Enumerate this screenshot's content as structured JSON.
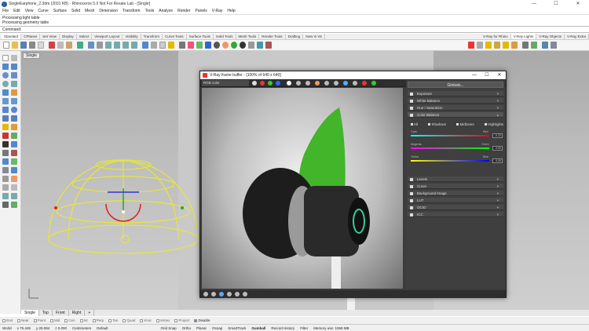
{
  "app": {
    "title": "SingleEarphone_2.3dm (2031 KB) - Rhinoceros 5.0 Not For Resale Lab - [Single]"
  },
  "window_controls": {
    "minimize": "—",
    "maximize": "☐",
    "close": "✕"
  },
  "menu": [
    "File",
    "Edit",
    "View",
    "Curve",
    "Surface",
    "Solid",
    "Mesh",
    "Dimension",
    "Transform",
    "Tools",
    "Analyze",
    "Render",
    "Panels",
    "V-Ray",
    "Help"
  ],
  "history": [
    "Processing light table",
    "Processing geometry table"
  ],
  "command": {
    "label": "Command:"
  },
  "toolbar_tabs": [
    "Standard",
    "CPlanes",
    "Set View",
    "Display",
    "Select",
    "Viewport Layout",
    "Visibility",
    "Transform",
    "Curve Tools",
    "Surface Tools",
    "Solid Tools",
    "Mesh Tools",
    "Render Tools",
    "Drafting",
    "New in V5"
  ],
  "right_tabs": [
    "V-Ray for Rhino",
    "V-Ray Lights",
    "V-Ray Objects",
    "V-Ray Extra"
  ],
  "viewport": {
    "name": "Single"
  },
  "viewport_tabs": [
    "Single",
    "Top",
    "Front",
    "Right",
    "+"
  ],
  "osnaps": [
    "End",
    "Near",
    "Point",
    "Mid",
    "Cen",
    "Int",
    "Perp",
    "Tan",
    "Quad",
    "Knot",
    "Vertex",
    "Project",
    "Disable"
  ],
  "status": {
    "cplane": "World",
    "x": "x 75.449",
    "y": "y 25.094",
    "z": "z 0.000",
    "units": "Centimeters",
    "layer": "Default",
    "items": [
      "Grid Snap",
      "Ortho",
      "Planar",
      "Osnap",
      "SmartTrack",
      "Gumball",
      "Record History",
      "Filter"
    ],
    "memory": "Memory use: 1069 MB"
  },
  "vfb": {
    "title": "V-Ray frame buffer - [100% of 640 x 640]",
    "channel": "RGB color",
    "globals_label": "Globals...",
    "layers": [
      "Exposure",
      "White Balance",
      "Hue / Saturation",
      "Color Balance"
    ],
    "cb_options": [
      "All",
      "Shadows",
      "Midtones",
      "Highlights"
    ],
    "sliders": [
      {
        "left": "Cyan",
        "right": "Red",
        "value": "-0.22"
      },
      {
        "left": "Magenta",
        "right": "Green",
        "value": "0.00"
      },
      {
        "left": "Yellow",
        "right": "Blue",
        "value": "0.00"
      }
    ],
    "layers2": [
      "Levels",
      "Curve",
      "Background Image",
      "LUT",
      "OCIO",
      "ICC"
    ]
  }
}
